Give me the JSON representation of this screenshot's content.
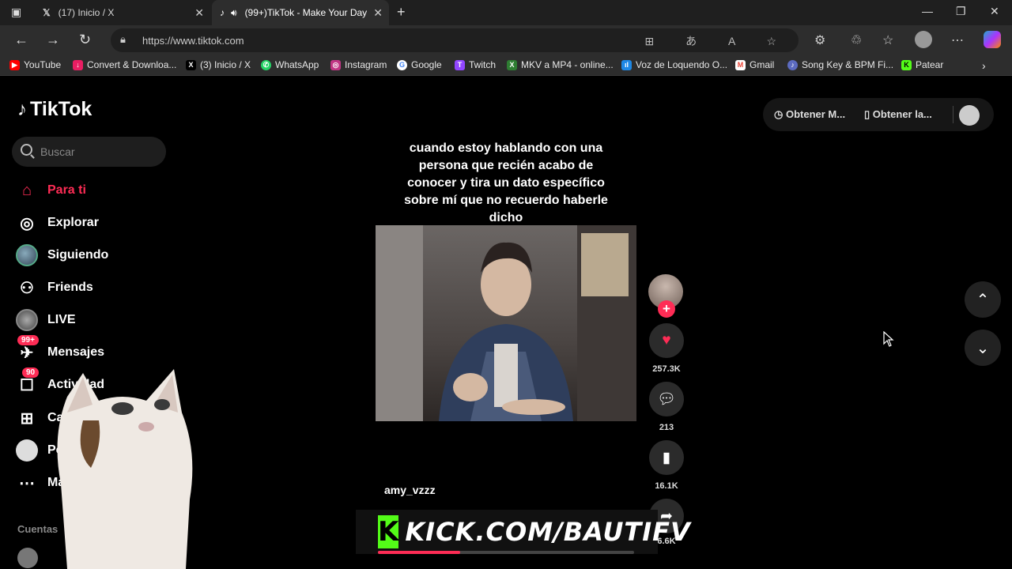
{
  "browser": {
    "tabs": [
      {
        "title": "(17) Inicio / X"
      },
      {
        "title": "(99+)TikTok - Make Your Day"
      }
    ],
    "url": "https://www.tiktok.com",
    "bookmarks": [
      {
        "label": "YouTube",
        "icon": "youtube-icon",
        "color": "#ff0000"
      },
      {
        "label": "Convert & Downloa...",
        "icon": "download-icon",
        "color": "#e91e63"
      },
      {
        "label": "(3) Inicio / X",
        "icon": "x-icon",
        "color": "#000000"
      },
      {
        "label": "WhatsApp",
        "icon": "whatsapp-icon",
        "color": "#25d366"
      },
      {
        "label": "Instagram",
        "icon": "instagram-icon",
        "color": "#c13584"
      },
      {
        "label": "Google",
        "icon": "google-icon",
        "color": "#4285f4"
      },
      {
        "label": "Twitch",
        "icon": "twitch-icon",
        "color": "#9146ff"
      },
      {
        "label": "MKV a MP4 - online...",
        "icon": "convert-icon",
        "color": "#2e7d32"
      },
      {
        "label": "Voz de Loquendo O...",
        "icon": "audio-icon",
        "color": "#1e88e5"
      },
      {
        "label": "Gmail",
        "icon": "gmail-icon",
        "color": "#ea4335"
      },
      {
        "label": "Song Key & BPM Fi...",
        "icon": "music-icon",
        "color": "#5c6bc0"
      },
      {
        "label": "Patear",
        "icon": "kick-icon",
        "color": "#53fc18"
      }
    ]
  },
  "tiktok": {
    "logo": "TikTok",
    "search_placeholder": "Buscar",
    "nav": [
      {
        "label": "Para ti",
        "icon": "home-icon",
        "active": true
      },
      {
        "label": "Explorar",
        "icon": "compass-icon"
      },
      {
        "label": "Siguiendo",
        "icon": "following-avatar-icon"
      },
      {
        "label": "Friends",
        "icon": "friends-icon"
      },
      {
        "label": "LIVE",
        "icon": "live-icon"
      },
      {
        "label": "Mensajes",
        "icon": "message-icon",
        "badge": "99+"
      },
      {
        "label": "Actividad",
        "icon": "activity-icon",
        "badge": "90"
      },
      {
        "label": "Cargar",
        "icon": "upload-icon"
      },
      {
        "label": "Perfil",
        "icon": "profile-icon"
      },
      {
        "label": "Más",
        "icon": "more-icon"
      }
    ],
    "accounts_label": "Cuentas",
    "top_buttons": {
      "get_coins": "Obtener M...",
      "get_app": "Obtener la..."
    },
    "video": {
      "caption": "cuando estoy hablando con una persona que recién acabo de conocer y tira un dato específico sobre mí que no recuerdo haberle dicho",
      "username": "amy_vzzz",
      "likes": "257.3K",
      "comments": "213",
      "saves": "16.1K",
      "shares": "6.6K",
      "progress": 0.32
    },
    "overlay": {
      "kick_letter": "K",
      "kick_text": "KICK.COM/BAUTIFV"
    }
  }
}
